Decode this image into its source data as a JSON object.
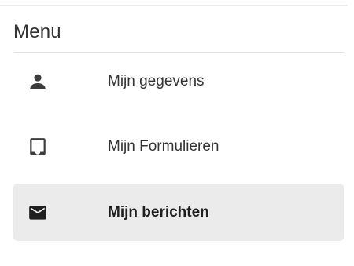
{
  "menu": {
    "title": "Menu",
    "items": [
      {
        "label": "Mijn gegevens",
        "icon": "person-icon",
        "active": false
      },
      {
        "label": "Mijn Formulieren",
        "icon": "inbox-icon",
        "active": false
      },
      {
        "label": "Mijn berichten",
        "icon": "envelope-icon",
        "active": true
      }
    ]
  },
  "colors": {
    "text": "#333333",
    "icon": "#3c3c3c",
    "active_background": "#ebebeb",
    "divider": "#e2e2e2"
  }
}
